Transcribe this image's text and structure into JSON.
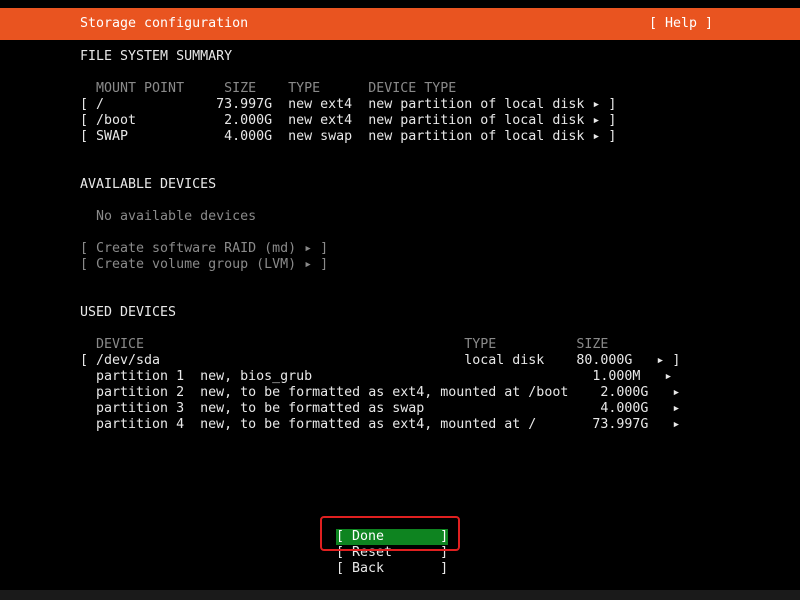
{
  "header": {
    "title": "Storage configuration",
    "help": "[ Help ]"
  },
  "fs_summary": {
    "heading": "FILE SYSTEM SUMMARY",
    "columns_line": "  MOUNT POINT     SIZE    TYPE      DEVICE TYPE",
    "rows": [
      "[ /              73.997G  new ext4  new partition of local disk ▸ ]",
      "[ /boot           2.000G  new ext4  new partition of local disk ▸ ]",
      "[ SWAP            4.000G  new swap  new partition of local disk ▸ ]"
    ]
  },
  "available": {
    "heading": "AVAILABLE DEVICES",
    "empty_text": "  No available devices",
    "actions": [
      "[ Create software RAID (md) ▸ ]",
      "[ Create volume group (LVM) ▸ ]"
    ]
  },
  "used": {
    "heading": "USED DEVICES",
    "columns_line": "  DEVICE                                        TYPE          SIZE",
    "device_row": "[ /dev/sda                                      local disk    80.000G   ▸ ]",
    "partitions": [
      "  partition 1  new, bios_grub                                   1.000M   ▸",
      "  partition 2  new, to be formatted as ext4, mounted at /boot    2.000G   ▸",
      "  partition 3  new, to be formatted as swap                      4.000G   ▸",
      "  partition 4  new, to be formatted as ext4, mounted at /       73.997G   ▸"
    ]
  },
  "buttons": {
    "done": "[ Done       ]",
    "reset": "[ Reset      ]",
    "back": "[ Back       ]"
  },
  "colors": {
    "header_bg": "#e95420",
    "done_bg": "#0e8420",
    "highlight_border": "#e02020"
  }
}
